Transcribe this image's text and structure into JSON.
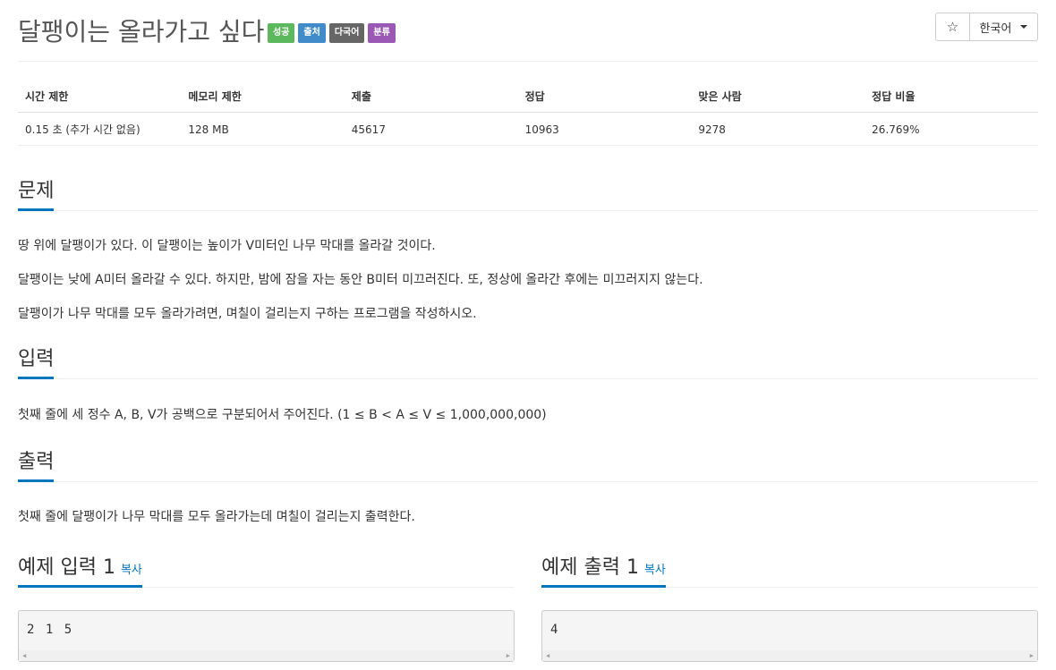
{
  "problem": {
    "title": "달팽이는 올라가고 싶다",
    "labels": [
      "성공",
      "출처",
      "다국어",
      "분류"
    ]
  },
  "toolbar": {
    "star_icon": "☆",
    "language": "한국어"
  },
  "info_table": {
    "headers": [
      "시간 제한",
      "메모리 제한",
      "제출",
      "정답",
      "맞은 사람",
      "정답 비율"
    ],
    "values": [
      "0.15 초 (추가 시간 없음)",
      "128 MB",
      "45617",
      "10963",
      "9278",
      "26.769%"
    ]
  },
  "sections": {
    "description": {
      "heading": "문제",
      "paragraphs": [
        "땅 위에 달팽이가 있다. 이 달팽이는 높이가 V미터인 나무 막대를 올라갈 것이다.",
        "달팽이는 낮에 A미터 올라갈 수 있다. 하지만, 밤에 잠을 자는 동안 B미터 미끄러진다. 또, 정상에 올라간 후에는 미끄러지지 않는다.",
        "달팽이가 나무 막대를 모두 올라가려면, 며칠이 걸리는지 구하는 프로그램을 작성하시오."
      ]
    },
    "input": {
      "heading": "입력",
      "text": "첫째 줄에 세 정수 A, B, V가 공백으로 구분되어서 주어진다. (1 ≤ B < A ≤ V ≤ 1,000,000,000)"
    },
    "output": {
      "heading": "출력",
      "text": "첫째 줄에 달팽이가 나무 막대를 모두 올라가는데 며칠이 걸리는지 출력한다."
    }
  },
  "samples": {
    "input": {
      "heading": "예제 입력 1",
      "copy": "복사",
      "content": "2 1 5"
    },
    "output": {
      "heading": "예제 출력 1",
      "copy": "복사",
      "content": "4"
    }
  }
}
